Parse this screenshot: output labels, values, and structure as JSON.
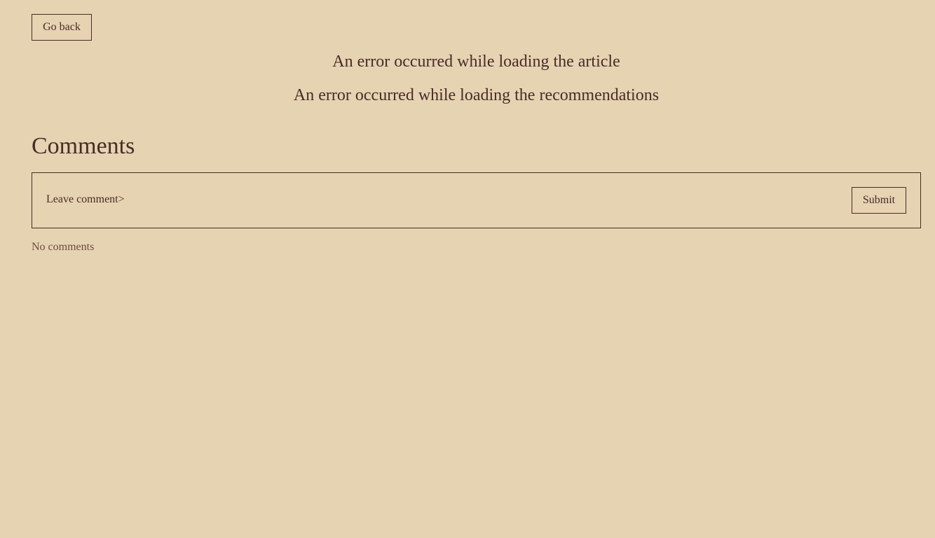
{
  "nav": {
    "go_back_label": "Go back"
  },
  "errors": {
    "article": "An error occurred while loading the article",
    "recommendations": "An error occurred while loading the recommendations"
  },
  "comments": {
    "title": "Comments",
    "form": {
      "label": "Leave comment>",
      "value": "",
      "submit_label": "Submit"
    },
    "empty_text": "No comments"
  },
  "colors": {
    "background": "#e5d3b2",
    "text": "#4a2b26"
  }
}
